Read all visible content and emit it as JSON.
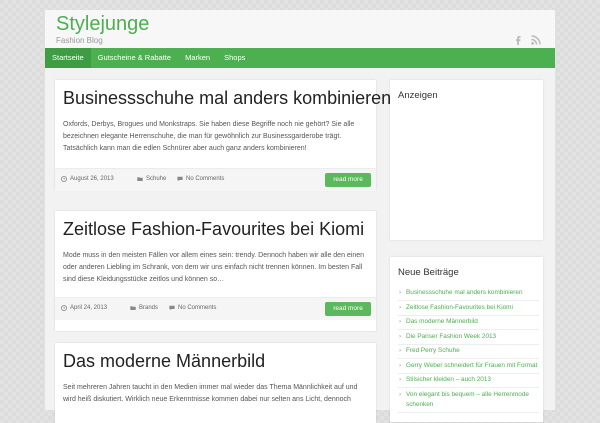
{
  "site": {
    "title": "Stylejunge",
    "tagline": "Fashion Blog"
  },
  "social": [
    {
      "icon": "facebook-icon"
    },
    {
      "icon": "rss-icon"
    }
  ],
  "nav": [
    {
      "label": "Startseite",
      "active": true
    },
    {
      "label": "Gutscheine & Rabatte",
      "active": false
    },
    {
      "label": "Marken",
      "active": false
    },
    {
      "label": "Shops",
      "active": false
    }
  ],
  "posts": [
    {
      "title": "Businessschuhe mal anders kombinieren",
      "excerpt": "Oxfords, Derbys, Brogues und Monkstraps. Sie haben diese Begriffe noch nie gehört? Sie alle bezeichnen elegante Herrenschuhe, die man für gewöhnlich zur Businessgarderobe trägt. Tatsächlich kann man die edlen Schnürer aber auch ganz anders kombinieren!",
      "date": "August 26, 2013",
      "category": "Schuhe",
      "comments": "No Comments",
      "more": "read more"
    },
    {
      "title": "Zeitlose Fashion-Favourites bei Kiomi",
      "excerpt": "Mode muss in den meisten Fällen vor allem eines sein: trendy. Dennoch haben wir alle den einen oder anderen Liebling im Schrank, von dem wir uns einfach nicht trennen können. Im besten Fall sind diese Kleidungsstücke zeitlos und können so…",
      "date": "April 24, 2013",
      "category": "Brands",
      "comments": "No Comments",
      "more": "read more"
    },
    {
      "title": "Das moderne Männerbild",
      "excerpt": "Seit mehreren Jahren taucht in den Medien immer mal wieder das Thema Männlichkeit auf und wird heiß diskutiert. Wirklich neue Erkenntnisse kommen dabei nur selten ans Licht, dennoch"
    }
  ],
  "sidebar": {
    "ads_title": "Anzeigen",
    "recent_title": "Neue Beiträge",
    "recent": [
      "Businessschuhe mal anders kombinieren",
      "Zeitlose Fashion-Favourites bei Kiomi",
      "Das moderne Männerbild",
      "Die Pariser Fashion Week 2013",
      "Fred Perry Schuhe",
      "Gerry Weber schneidert für Frauen mit Format",
      "Stilsicher kleiden – auch 2013",
      "Von elegant bis bequem – alle Herrenmode schenken"
    ]
  },
  "colors": {
    "accent": "#4caf50",
    "nav": "#4caf50",
    "button": "#5cb85c"
  }
}
